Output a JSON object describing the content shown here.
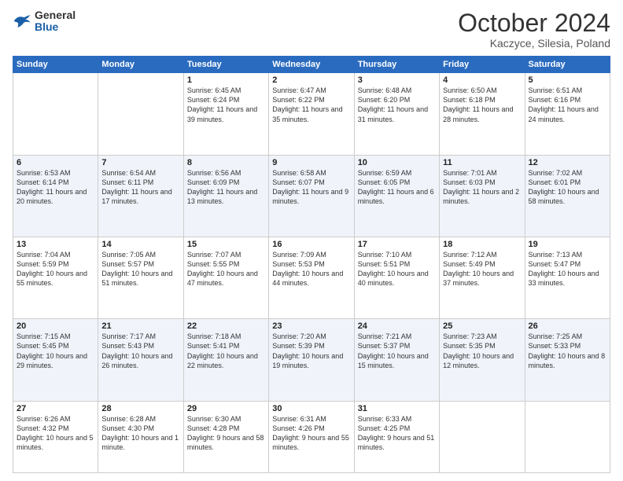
{
  "header": {
    "logo": {
      "general": "General",
      "blue": "Blue"
    },
    "title": "October 2024",
    "location": "Kaczyce, Silesia, Poland"
  },
  "weekdays": [
    "Sunday",
    "Monday",
    "Tuesday",
    "Wednesday",
    "Thursday",
    "Friday",
    "Saturday"
  ],
  "weeks": [
    [
      {
        "day": "",
        "info": ""
      },
      {
        "day": "",
        "info": ""
      },
      {
        "day": "1",
        "info": "Sunrise: 6:45 AM\nSunset: 6:24 PM\nDaylight: 11 hours and 39 minutes."
      },
      {
        "day": "2",
        "info": "Sunrise: 6:47 AM\nSunset: 6:22 PM\nDaylight: 11 hours and 35 minutes."
      },
      {
        "day": "3",
        "info": "Sunrise: 6:48 AM\nSunset: 6:20 PM\nDaylight: 11 hours and 31 minutes."
      },
      {
        "day": "4",
        "info": "Sunrise: 6:50 AM\nSunset: 6:18 PM\nDaylight: 11 hours and 28 minutes."
      },
      {
        "day": "5",
        "info": "Sunrise: 6:51 AM\nSunset: 6:16 PM\nDaylight: 11 hours and 24 minutes."
      }
    ],
    [
      {
        "day": "6",
        "info": "Sunrise: 6:53 AM\nSunset: 6:14 PM\nDaylight: 11 hours and 20 minutes."
      },
      {
        "day": "7",
        "info": "Sunrise: 6:54 AM\nSunset: 6:11 PM\nDaylight: 11 hours and 17 minutes."
      },
      {
        "day": "8",
        "info": "Sunrise: 6:56 AM\nSunset: 6:09 PM\nDaylight: 11 hours and 13 minutes."
      },
      {
        "day": "9",
        "info": "Sunrise: 6:58 AM\nSunset: 6:07 PM\nDaylight: 11 hours and 9 minutes."
      },
      {
        "day": "10",
        "info": "Sunrise: 6:59 AM\nSunset: 6:05 PM\nDaylight: 11 hours and 6 minutes."
      },
      {
        "day": "11",
        "info": "Sunrise: 7:01 AM\nSunset: 6:03 PM\nDaylight: 11 hours and 2 minutes."
      },
      {
        "day": "12",
        "info": "Sunrise: 7:02 AM\nSunset: 6:01 PM\nDaylight: 10 hours and 58 minutes."
      }
    ],
    [
      {
        "day": "13",
        "info": "Sunrise: 7:04 AM\nSunset: 5:59 PM\nDaylight: 10 hours and 55 minutes."
      },
      {
        "day": "14",
        "info": "Sunrise: 7:05 AM\nSunset: 5:57 PM\nDaylight: 10 hours and 51 minutes."
      },
      {
        "day": "15",
        "info": "Sunrise: 7:07 AM\nSunset: 5:55 PM\nDaylight: 10 hours and 47 minutes."
      },
      {
        "day": "16",
        "info": "Sunrise: 7:09 AM\nSunset: 5:53 PM\nDaylight: 10 hours and 44 minutes."
      },
      {
        "day": "17",
        "info": "Sunrise: 7:10 AM\nSunset: 5:51 PM\nDaylight: 10 hours and 40 minutes."
      },
      {
        "day": "18",
        "info": "Sunrise: 7:12 AM\nSunset: 5:49 PM\nDaylight: 10 hours and 37 minutes."
      },
      {
        "day": "19",
        "info": "Sunrise: 7:13 AM\nSunset: 5:47 PM\nDaylight: 10 hours and 33 minutes."
      }
    ],
    [
      {
        "day": "20",
        "info": "Sunrise: 7:15 AM\nSunset: 5:45 PM\nDaylight: 10 hours and 29 minutes."
      },
      {
        "day": "21",
        "info": "Sunrise: 7:17 AM\nSunset: 5:43 PM\nDaylight: 10 hours and 26 minutes."
      },
      {
        "day": "22",
        "info": "Sunrise: 7:18 AM\nSunset: 5:41 PM\nDaylight: 10 hours and 22 minutes."
      },
      {
        "day": "23",
        "info": "Sunrise: 7:20 AM\nSunset: 5:39 PM\nDaylight: 10 hours and 19 minutes."
      },
      {
        "day": "24",
        "info": "Sunrise: 7:21 AM\nSunset: 5:37 PM\nDaylight: 10 hours and 15 minutes."
      },
      {
        "day": "25",
        "info": "Sunrise: 7:23 AM\nSunset: 5:35 PM\nDaylight: 10 hours and 12 minutes."
      },
      {
        "day": "26",
        "info": "Sunrise: 7:25 AM\nSunset: 5:33 PM\nDaylight: 10 hours and 8 minutes."
      }
    ],
    [
      {
        "day": "27",
        "info": "Sunrise: 6:26 AM\nSunset: 4:32 PM\nDaylight: 10 hours and 5 minutes."
      },
      {
        "day": "28",
        "info": "Sunrise: 6:28 AM\nSunset: 4:30 PM\nDaylight: 10 hours and 1 minute."
      },
      {
        "day": "29",
        "info": "Sunrise: 6:30 AM\nSunset: 4:28 PM\nDaylight: 9 hours and 58 minutes."
      },
      {
        "day": "30",
        "info": "Sunrise: 6:31 AM\nSunset: 4:26 PM\nDaylight: 9 hours and 55 minutes."
      },
      {
        "day": "31",
        "info": "Sunrise: 6:33 AM\nSunset: 4:25 PM\nDaylight: 9 hours and 51 minutes."
      },
      {
        "day": "",
        "info": ""
      },
      {
        "day": "",
        "info": ""
      }
    ]
  ]
}
